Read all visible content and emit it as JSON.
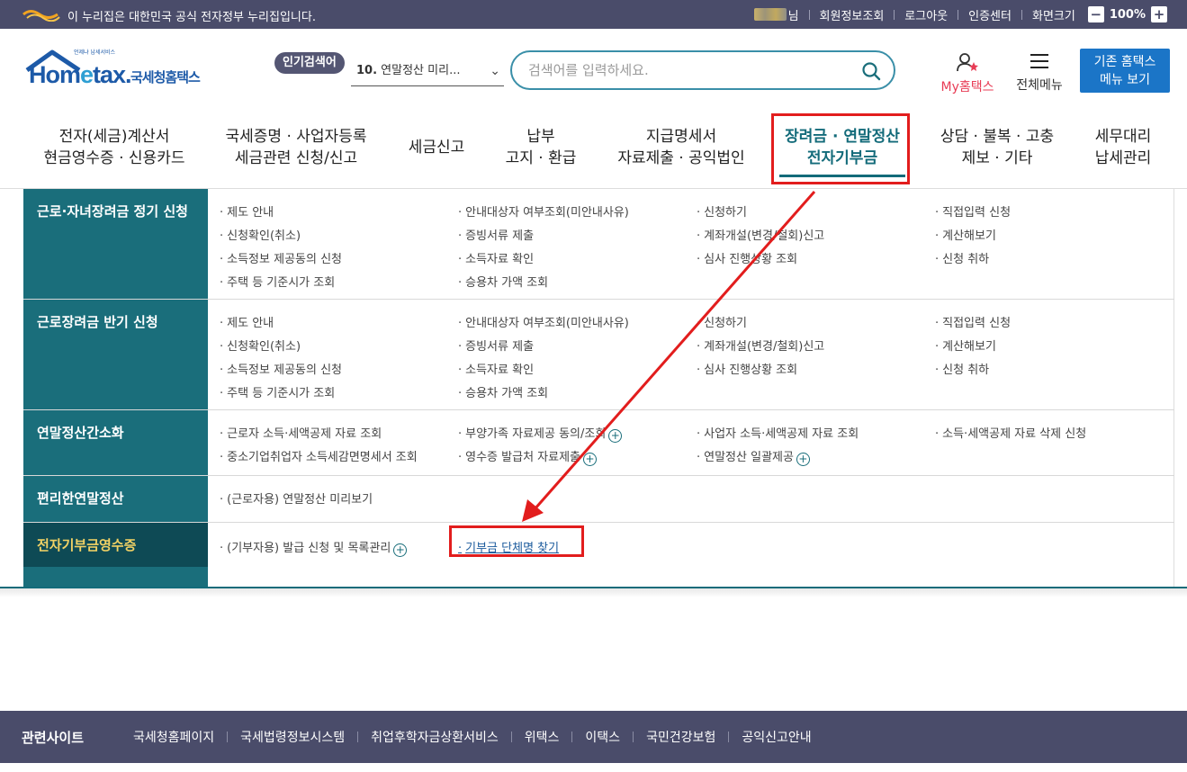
{
  "gov_bar": {
    "notice": "이 누리집은 대한민국 공식 전자정부 누리집입니다.",
    "user_suffix": "님",
    "links": [
      "회원정보조회",
      "로그아웃",
      "인증센터"
    ],
    "zoom_label": "화면크기",
    "zoom_level": "100%",
    "zoom_minus": "−",
    "zoom_plus": "+"
  },
  "header": {
    "logo_text_main": "Hom",
    "logo_text_e": "e",
    "logo_text_tail": "tax.",
    "logo_korean": "국세청홈택스",
    "logo_tag": "언제냐 납세서비스",
    "popular_badge": "인기검색어",
    "popular_rank": "10.",
    "popular_term": "연말정산 미리...",
    "search_placeholder": "검색어를 입력하세요.",
    "my_hometax": "My홈택스",
    "all_menu": "전체메뉴",
    "legacy_line1": "기존 홈택스",
    "legacy_line2": "메뉴 보기"
  },
  "nav": [
    {
      "line1": "전자(세금)계산서",
      "line2": "현금영수증 · 신용카드"
    },
    {
      "line1": "국세증명 · 사업자등록",
      "line2": "세금관련 신청/신고"
    },
    {
      "line1": "세금신고",
      "line2": ""
    },
    {
      "line1": "납부",
      "line2": "고지 · 환급"
    },
    {
      "line1": "지급명세서",
      "line2": "자료제출 · 공익법인"
    },
    {
      "line1": "장려금 · 연말정산",
      "line2": "전자기부금"
    },
    {
      "line1": "상담 · 불복 · 고충",
      "line2": "제보 · 기타"
    },
    {
      "line1": "세무대리",
      "line2": "납세관리"
    }
  ],
  "sections": [
    {
      "title": "근로·자녀장려금 정기 신청",
      "links": [
        [
          "제도 안내",
          "안내대상자 여부조회(미안내사유)",
          "신청하기",
          "직접입력 신청"
        ],
        [
          "신청확인(취소)",
          "증빙서류 제출",
          "계좌개설(변경/철회)신고",
          "계산해보기"
        ],
        [
          "소득정보 제공동의 신청",
          "소득자료 확인",
          "심사 진행상황 조회",
          "신청 취하"
        ],
        [
          "주택 등 기준시가 조회",
          "승용차 가액 조회"
        ]
      ]
    },
    {
      "title": "근로장려금 반기 신청",
      "links": [
        [
          "제도 안내",
          "안내대상자 여부조회(미안내사유)",
          "신청하기",
          "직접입력 신청"
        ],
        [
          "신청확인(취소)",
          "증빙서류 제출",
          "계좌개설(변경/철회)신고",
          "계산해보기"
        ],
        [
          "소득정보 제공동의 신청",
          "소득자료 확인",
          "심사 진행상황 조회",
          "신청 취하"
        ],
        [
          "주택 등 기준시가 조회",
          "승용차 가액 조회"
        ]
      ]
    },
    {
      "title": "연말정산간소화",
      "links": [
        [
          "근로자 소득·세액공제 자료 조회",
          "부양가족 자료제공 동의/조회",
          "사업자 소득·세액공제 자료 조회",
          "소득·세액공제 자료 삭제 신청"
        ],
        [
          "중소기업취업자 소득세감면명세서 조회",
          "영수증 발급처 자료제출",
          "연말정산 일괄제공"
        ]
      ]
    },
    {
      "title": "편리한연말정산",
      "links": [
        [
          "(근로자용) 연말정산 미리보기"
        ]
      ]
    },
    {
      "title": "전자기부금영수증",
      "links": [
        [
          "(기부자용) 발급 신청 및 목록관리",
          "기부금 단체명 찾기"
        ]
      ]
    }
  ],
  "footer": {
    "title": "관련사이트",
    "links": [
      "국세청홈페이지",
      "국세법령정보시스템",
      "취업후학자금상환서비스",
      "위택스",
      "이택스",
      "국민건강보험",
      "공익신고안내"
    ]
  },
  "colors": {
    "gov_bar": "#4a4c6a",
    "teal": "#1a6e7b",
    "active_dark": "#0e4a55",
    "highlight_yellow": "#f2d265",
    "annotation_red": "#e21d1d",
    "legacy_blue": "#1b75c7",
    "my_pink": "#e83c55"
  }
}
